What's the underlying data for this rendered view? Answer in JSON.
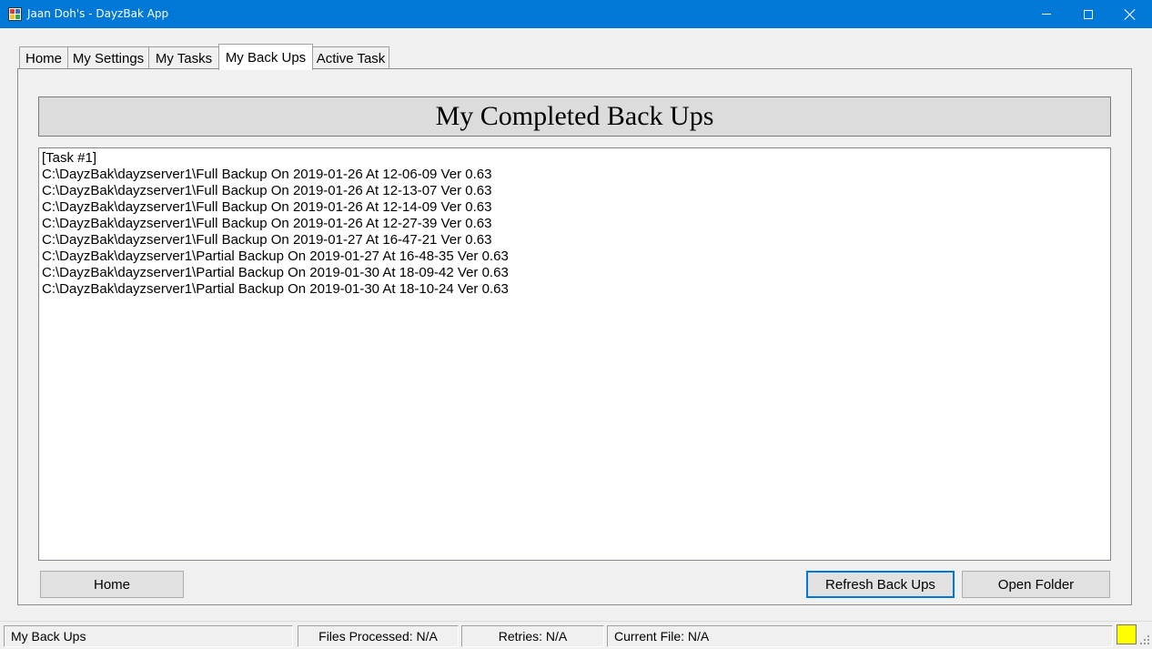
{
  "window": {
    "title": "Jaan Doh's - DayzBak App",
    "icon": "app-icon",
    "controls": [
      "minimize-icon",
      "maximize-icon",
      "close-icon"
    ]
  },
  "tabs": [
    {
      "label": "Home",
      "selected": false
    },
    {
      "label": "My Settings",
      "selected": false
    },
    {
      "label": "My Tasks",
      "selected": false
    },
    {
      "label": "My Back Ups",
      "selected": true
    },
    {
      "label": "Active Task",
      "selected": false
    }
  ],
  "panel": {
    "title": "My Completed Back Ups",
    "items": [
      "[Task #1]",
      "C:\\DayzBak\\dayzserver1\\Full Backup On 2019-01-26 At 12-06-09 Ver 0.63",
      "C:\\DayzBak\\dayzserver1\\Full Backup On 2019-01-26 At 12-13-07 Ver 0.63",
      "C:\\DayzBak\\dayzserver1\\Full Backup On 2019-01-26 At 12-14-09 Ver 0.63",
      "C:\\DayzBak\\dayzserver1\\Full Backup On 2019-01-26 At 12-27-39 Ver 0.63",
      "C:\\DayzBak\\dayzserver1\\Full Backup On 2019-01-27 At 16-47-21 Ver 0.63",
      "C:\\DayzBak\\dayzserver1\\Partial Backup On 2019-01-27 At 16-48-35 Ver 0.63",
      "C:\\DayzBak\\dayzserver1\\Partial Backup On 2019-01-30 At 18-09-42 Ver 0.63",
      "C:\\DayzBak\\dayzserver1\\Partial Backup On 2019-01-30 At 18-10-24 Ver 0.63"
    ],
    "buttons": {
      "home": "Home",
      "refresh": "Refresh Back Ups",
      "open_folder": "Open Folder"
    }
  },
  "status": {
    "view": "My Back Ups",
    "files_processed": "Files Processed: N/A",
    "retries": "Retries: N/A",
    "current_file": "Current File: N/A",
    "indicator_color": "#ffff00"
  },
  "colors": {
    "titlebar": "#0078d7",
    "focus_border": "#0078d7",
    "background": "#f0f0f0"
  }
}
